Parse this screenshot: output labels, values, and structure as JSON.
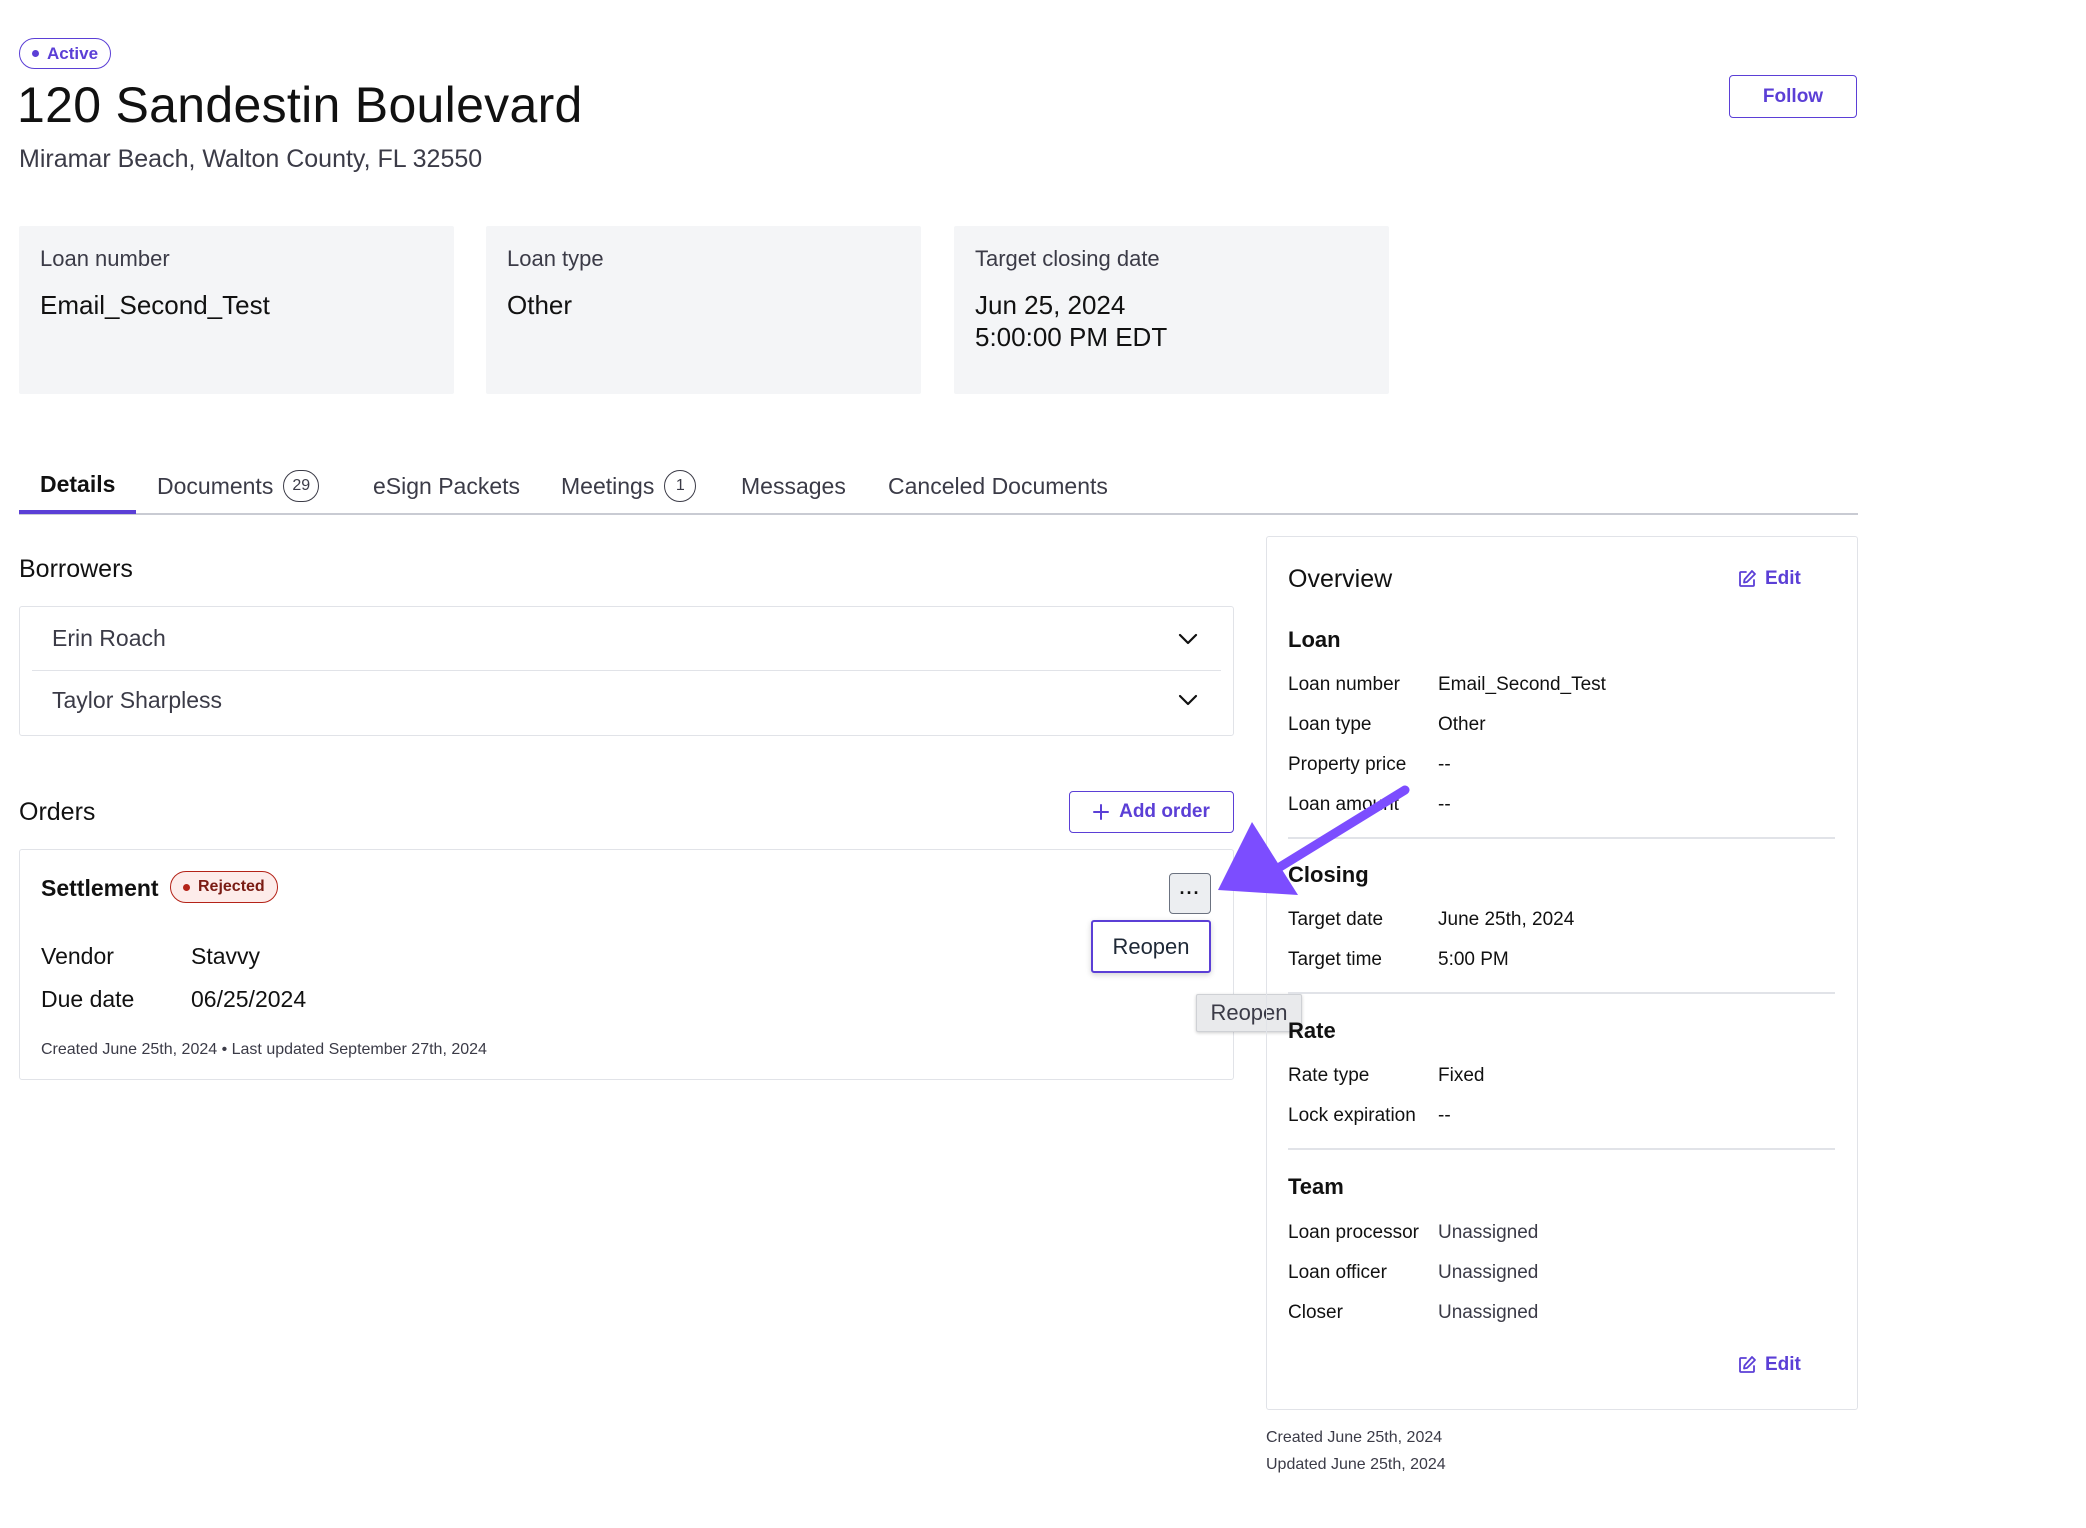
{
  "header": {
    "status": "Active",
    "title": "120 Sandestin Boulevard",
    "subtitle": "Miramar Beach, Walton County, FL 32550",
    "follow_label": "Follow"
  },
  "summary_cards": [
    {
      "label": "Loan number",
      "value": "Email_Second_Test"
    },
    {
      "label": "Loan type",
      "value": "Other"
    },
    {
      "label": "Target closing date",
      "value_line1": "Jun 25, 2024",
      "value_line2": "5:00:00 PM EDT"
    }
  ],
  "tabs": [
    {
      "label": "Details",
      "active": true
    },
    {
      "label": "Documents",
      "count": "29"
    },
    {
      "label": "eSign Packets"
    },
    {
      "label": "Meetings",
      "count": "1"
    },
    {
      "label": "Messages"
    },
    {
      "label": "Canceled Documents"
    }
  ],
  "borrowers": {
    "heading": "Borrowers",
    "items": [
      "Erin Roach",
      "Taylor Sharpless"
    ]
  },
  "orders": {
    "heading": "Orders",
    "add_label": "Add order",
    "order": {
      "title": "Settlement",
      "status": "Rejected",
      "more_label": "···",
      "menu_item": "Reopen",
      "tooltip": "Reopen",
      "vendor_label": "Vendor",
      "vendor_value": "Stavvy",
      "due_label": "Due date",
      "due_value": "06/25/2024",
      "meta": "Created June 25th, 2024 • Last updated September 27th, 2024"
    }
  },
  "overview": {
    "title": "Overview",
    "edit_label": "Edit",
    "loan": {
      "heading": "Loan",
      "rows": [
        {
          "label": "Loan number",
          "value": "Email_Second_Test"
        },
        {
          "label": "Loan type",
          "value": "Other"
        },
        {
          "label": "Property price",
          "value": "--"
        },
        {
          "label": "Loan amount",
          "value": "--"
        }
      ]
    },
    "closing": {
      "heading": "Closing",
      "rows": [
        {
          "label": "Target date",
          "value": "June 25th, 2024"
        },
        {
          "label": "Target time",
          "value": "5:00 PM"
        }
      ]
    },
    "rate": {
      "heading": "Rate",
      "rows": [
        {
          "label": "Rate type",
          "value": "Fixed"
        },
        {
          "label": "Lock expiration",
          "value": "--"
        }
      ]
    },
    "team": {
      "heading": "Team",
      "rows": [
        {
          "label": "Loan processor",
          "value": "Unassigned"
        },
        {
          "label": "Loan officer",
          "value": "Unassigned"
        },
        {
          "label": "Closer",
          "value": "Unassigned"
        }
      ]
    },
    "team_edit_label": "Edit",
    "created": "Created June 25th, 2024",
    "updated": "Updated June 25th, 2024"
  },
  "colors": {
    "accent": "#5b3fd6",
    "arrow": "#7c4dff",
    "rejected": "#b42318"
  }
}
